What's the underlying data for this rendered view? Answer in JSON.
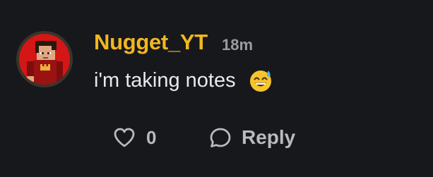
{
  "comment": {
    "username": "Nugget_YT",
    "timestamp": "18m",
    "message": "i'm taking notes",
    "emoji": "grinning-face-with-sweat",
    "like_count": "0",
    "reply_label": "Reply",
    "colors": {
      "background": "#17181c",
      "username": "#f2b61f",
      "timestamp": "#9a9ca1",
      "message": "#e8e9ec",
      "actions": "#b8babf",
      "avatar_background": "#d51616"
    }
  }
}
